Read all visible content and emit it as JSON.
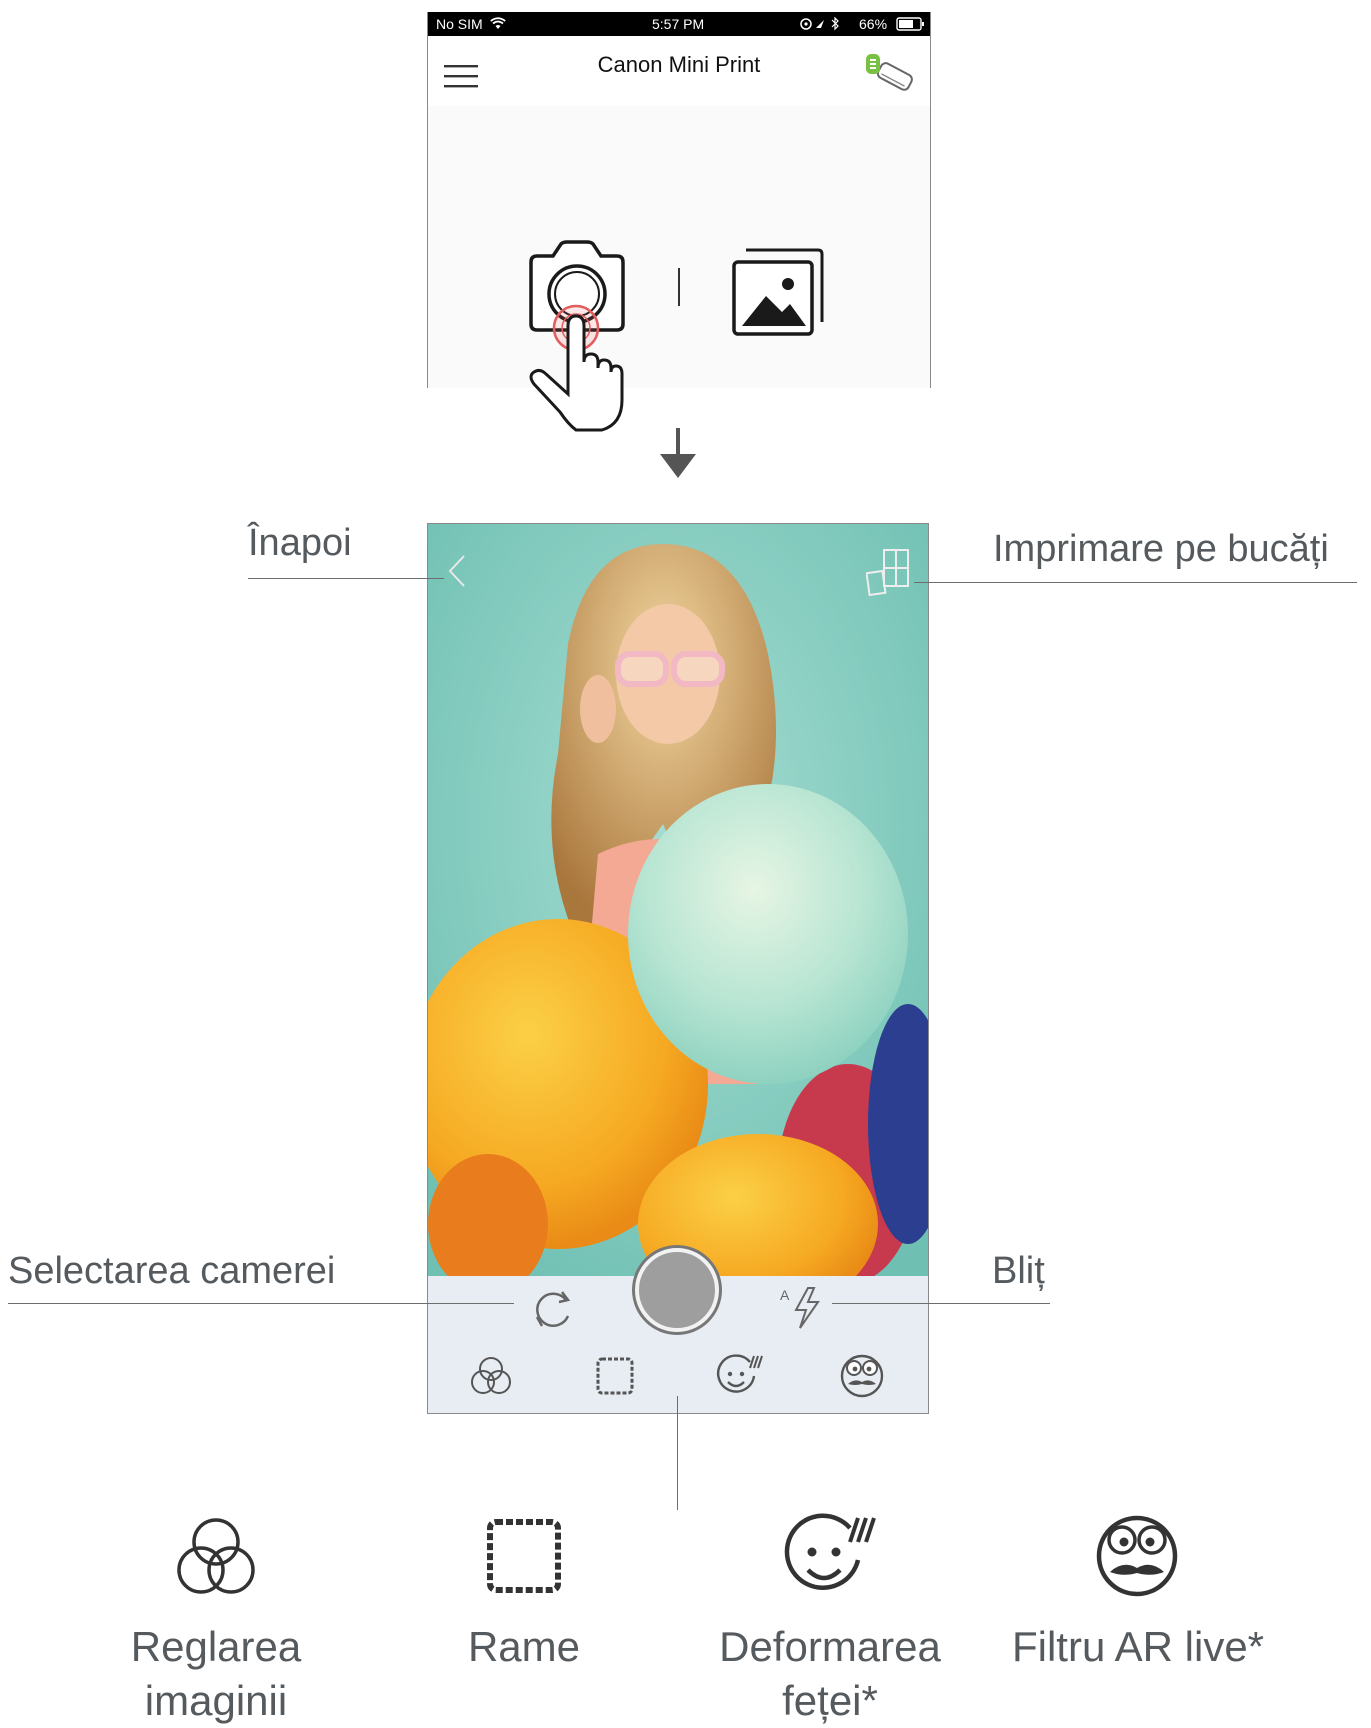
{
  "status_bar": {
    "carrier": "No SIM",
    "time": "5:57 PM",
    "battery": "66%"
  },
  "app_bar": {
    "title": "Canon Mini Print"
  },
  "callouts": {
    "back": "Înapoi",
    "tile_print": "Imprimare pe bucăți",
    "camera_select": "Selectarea camerei",
    "flash": "Bliț"
  },
  "features": [
    {
      "label": "Reglarea imaginii",
      "icon": "adjust-icon"
    },
    {
      "label": "Rame",
      "icon": "frame-icon"
    },
    {
      "label": "Deformarea feței*",
      "icon": "face-warp-icon"
    },
    {
      "label": "Filtru AR live*",
      "icon": "ar-filter-icon"
    }
  ],
  "icons": {
    "menu": "hamburger-icon",
    "printer": "printer-icon",
    "camera": "camera-icon",
    "gallery": "gallery-icon",
    "tap": "hand-tap-icon",
    "arrow": "arrow-down-icon",
    "back": "back-chevron-icon",
    "tile": "tile-print-icon",
    "switch_camera": "switch-camera-icon",
    "shutter": "shutter-button",
    "flash": "flash-auto-icon"
  },
  "colors": {
    "photo_background": "#8cd0c3",
    "toolbar_background": "#e8edf4",
    "printer_battery": "#7ac143",
    "tap_ring": "#e35d5d"
  }
}
